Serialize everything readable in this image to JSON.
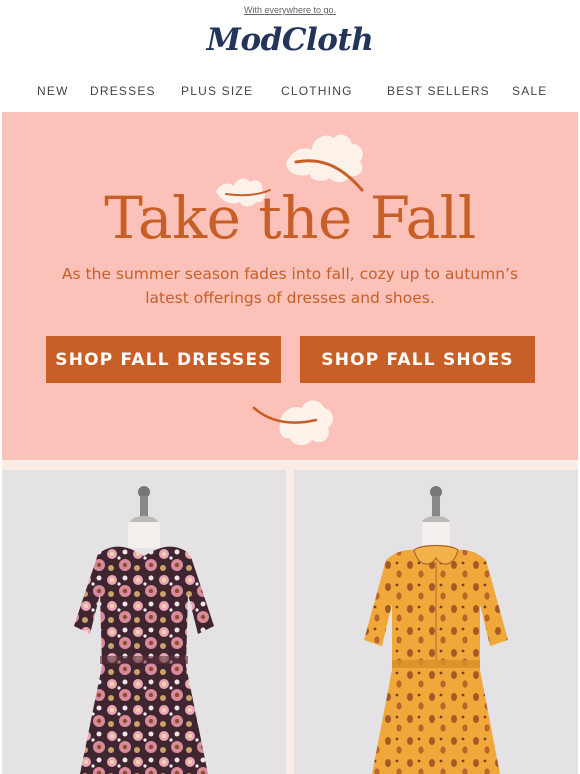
{
  "preheader": {
    "link_text": "With everywhere to go."
  },
  "brand": {
    "logo_text": "ModCloth"
  },
  "nav": {
    "items": [
      {
        "label": "NEW"
      },
      {
        "label": "DRESSES"
      },
      {
        "label": "PLUS SIZE"
      },
      {
        "label": "CLOTHING"
      },
      {
        "label": "BEST SELLERS"
      },
      {
        "label": "SALE"
      }
    ]
  },
  "hero": {
    "title": "Take the Fall",
    "subtitle_line1": "As the summer season fades into fall, cozy up to autumn’s",
    "subtitle_line2": "latest offerings of dresses and shoes.",
    "buttons": [
      {
        "label": "SHOP FALL DRESSES"
      },
      {
        "label": "SHOP FALL SHOES"
      }
    ]
  },
  "products": [
    {
      "image": "floral-print-dress-on-mannequin"
    },
    {
      "image": "mustard-acorn-print-dress-on-mannequin"
    }
  ],
  "colors": {
    "brand_navy": "#23355a",
    "hero_bg": "#fcc1b8",
    "accent_orange": "#c85f27",
    "leaf_cream": "#fdf2ea"
  }
}
